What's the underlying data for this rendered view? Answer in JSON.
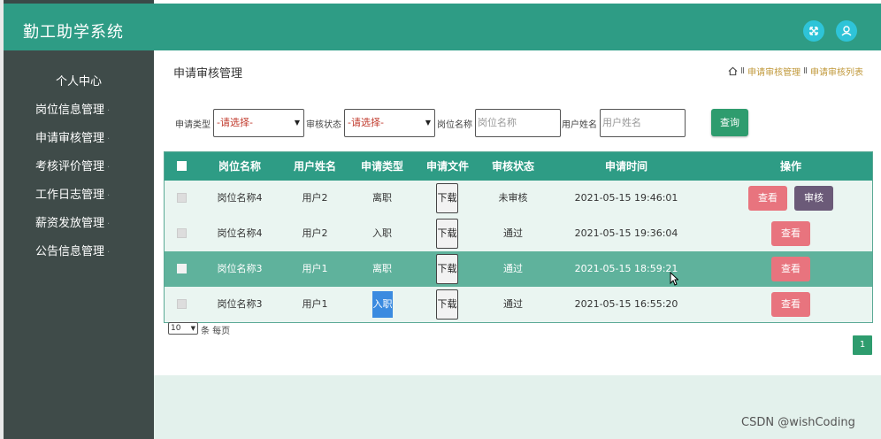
{
  "app": {
    "title": "勤工助学系统"
  },
  "header": {
    "icons": [
      "fullscreen-icon",
      "user-icon"
    ]
  },
  "sidebar": {
    "items": [
      {
        "label": "个人中心"
      },
      {
        "label": "岗位信息管理"
      },
      {
        "label": "申请审核管理"
      },
      {
        "label": "考核评价管理"
      },
      {
        "label": "工作日志管理"
      },
      {
        "label": "薪资发放管理"
      },
      {
        "label": "公告信息管理"
      }
    ]
  },
  "page": {
    "title": "申请审核管理",
    "breadcrumb": [
      "申请审核管理",
      "申请审核列表"
    ]
  },
  "filters": {
    "apply_type_label": "申请类型",
    "apply_type_value": "-请选择-",
    "audit_status_label": "审核状态",
    "audit_status_value": "-请选择-",
    "post_name_label": "岗位名称",
    "post_name_placeholder": "岗位名称",
    "user_name_label": "用户姓名",
    "user_name_placeholder": "用户姓名",
    "search_label": "查询"
  },
  "table": {
    "headers": [
      "岗位名称",
      "用户姓名",
      "申请类型",
      "申请文件",
      "审核状态",
      "申请时间",
      "操作"
    ],
    "rows": [
      {
        "post": "岗位名称4",
        "user": "用户2",
        "type": "离职",
        "file": "下载",
        "status": "未审核",
        "time": "2021-05-15 19:46:01",
        "view": "查看",
        "audit": "审核"
      },
      {
        "post": "岗位名称4",
        "user": "用户2",
        "type": "入职",
        "file": "下载",
        "status": "通过",
        "time": "2021-05-15 19:36:04",
        "view": "查看"
      },
      {
        "post": "岗位名称3",
        "user": "用户1",
        "type": "离职",
        "file": "下载",
        "status": "通过",
        "time": "2021-05-15 18:59:21",
        "view": "查看"
      },
      {
        "post": "岗位名称3",
        "user": "用户1",
        "type": "入职",
        "file": "下载",
        "status": "通过",
        "time": "2021-05-15 16:55:20",
        "view": "查看"
      }
    ]
  },
  "pager": {
    "page_size": "10",
    "per_page_label": "条 每页",
    "current_page": "1"
  },
  "watermark": "CSDN @wishCoding",
  "colors": {
    "header": "#2e9c85",
    "sidebar": "#3f4b49",
    "view_button": "#e8747e",
    "audit_button": "#6b5a78",
    "search_button": "#2e9c6e"
  }
}
